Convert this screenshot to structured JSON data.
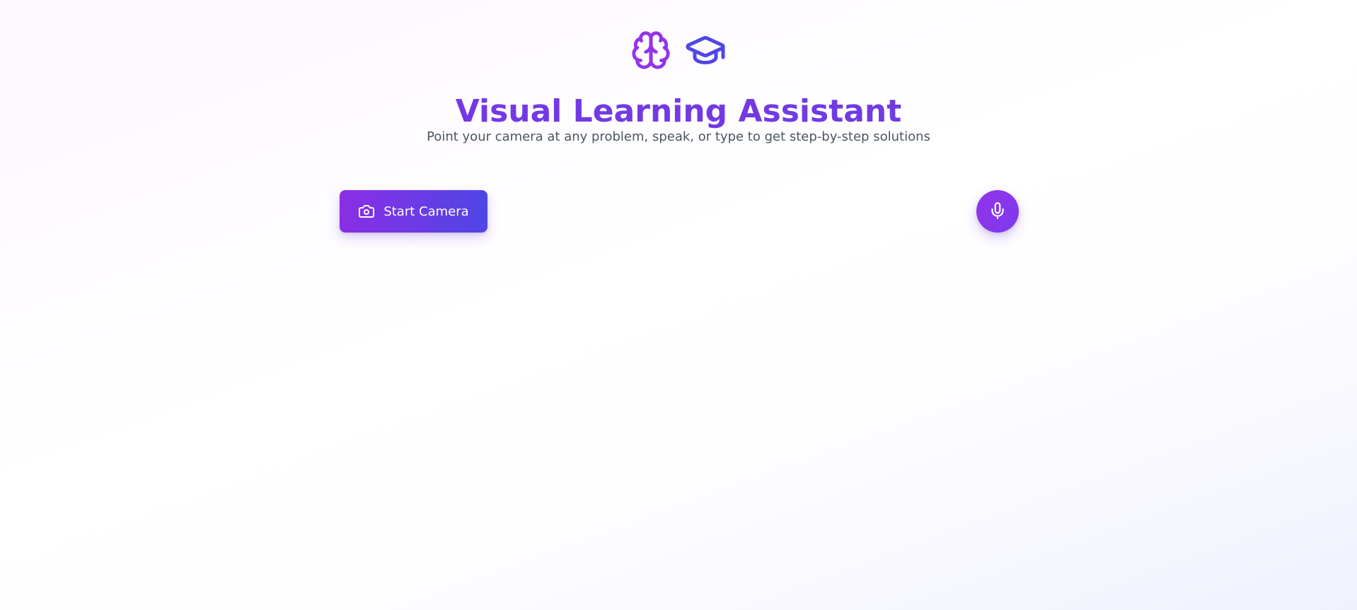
{
  "header": {
    "icons": [
      "brain-icon",
      "graduation-cap-icon"
    ],
    "title": "Visual Learning Assistant",
    "subtitle": "Point your camera at any problem, speak, or type to get step-by-step solutions"
  },
  "controls": {
    "start_camera_label": "Start Camera",
    "camera_icon": "camera-icon",
    "mic_icon": "microphone-icon"
  },
  "colors": {
    "brain_icon": "#9333ea",
    "cap_icon": "#4f46e5",
    "title": "#7337e3",
    "subtitle": "#4b5563",
    "button_gradient_start": "#8a2ee6",
    "button_gradient_end": "#4f46e5",
    "mic_button": "#9333ea"
  }
}
